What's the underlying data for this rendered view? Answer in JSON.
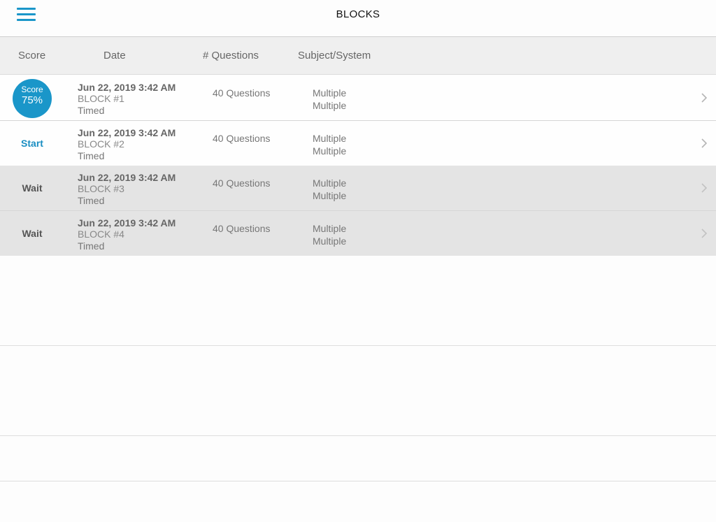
{
  "nav": {
    "title": "BLOCKS",
    "menu_icon": "hamburger-menu-icon",
    "accent_color": "#1a96c9"
  },
  "columns": {
    "score": "Score",
    "date": "Date",
    "questions": "# Questions",
    "subject": "Subject/System"
  },
  "rows": [
    {
      "status": "score",
      "score_label": "Score",
      "score_value": "75%",
      "date": "Jun 22, 2019 3:42 AM",
      "block": "BLOCK #1",
      "mode": "Timed",
      "questions": "40 Questions",
      "subject": "Multiple",
      "system": "Multiple"
    },
    {
      "status": "start",
      "action_label": "Start",
      "date": "Jun 22, 2019 3:42 AM",
      "block": "BLOCK #2",
      "mode": "Timed",
      "questions": "40 Questions",
      "subject": "Multiple",
      "system": "Multiple"
    },
    {
      "status": "wait",
      "action_label": "Wait",
      "date": "Jun 22, 2019 3:42 AM",
      "block": "BLOCK #3",
      "mode": "Timed",
      "questions": "40 Questions",
      "subject": "Multiple",
      "system": "Multiple"
    },
    {
      "status": "wait",
      "action_label": "Wait",
      "date": "Jun 22, 2019 3:42 AM",
      "block": "BLOCK #4",
      "mode": "Timed",
      "questions": "40 Questions",
      "subject": "Multiple",
      "system": "Multiple"
    }
  ]
}
